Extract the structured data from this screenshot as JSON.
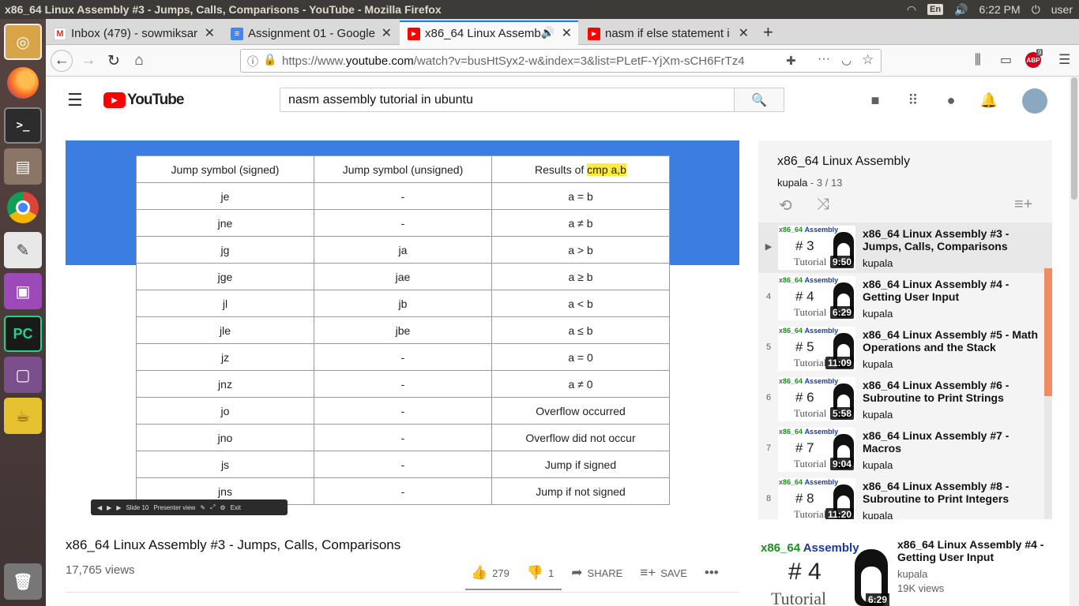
{
  "window": {
    "title": "x86_64 Linux Assembly #3 - Jumps, Calls, Comparisons - YouTube - Mozilla Firefox",
    "kbd_layout": "En",
    "time": "6:22 PM",
    "user": "user"
  },
  "launcher": {
    "items": [
      {
        "name": "ubuntu-dash",
        "glyph": "◎"
      },
      {
        "name": "firefox",
        "glyph": ""
      },
      {
        "name": "terminal",
        "glyph": ">_"
      },
      {
        "name": "files",
        "glyph": "▤"
      },
      {
        "name": "chrome",
        "glyph": ""
      },
      {
        "name": "text-editor",
        "glyph": "✎"
      },
      {
        "name": "app-window",
        "glyph": "▣"
      },
      {
        "name": "pycharm",
        "glyph": "PC"
      },
      {
        "name": "display",
        "glyph": "▢"
      },
      {
        "name": "teapot",
        "glyph": "☕"
      },
      {
        "name": "trash",
        "glyph": "🗑"
      }
    ]
  },
  "tabs": [
    {
      "title": "Inbox (479) - sowmiksar",
      "icon": "gmail-icon"
    },
    {
      "title": "Assignment 01 - Google",
      "icon": "docs-icon"
    },
    {
      "title": "x86_64 Linux Assemb",
      "icon": "youtube-icon"
    },
    {
      "title": "nasm if else statement i",
      "icon": "youtube-icon"
    }
  ],
  "nav": {
    "url_prefix": "https://www.",
    "url_domain": "youtube.com",
    "url_rest": "/watch?v=busHtSyx2-w&index=3&list=PLetF-YjXm-sCH6FrTz4",
    "abp_badge": "9"
  },
  "youtube": {
    "logo": "YouTube",
    "search_value": "nasm assembly tutorial in ubuntu"
  },
  "slide": {
    "headers": [
      "Jump symbol (signed)",
      "Jump symbol (unsigned)",
      "Results of "
    ],
    "highlight": "cmp a,b",
    "rows": [
      [
        "je",
        "-",
        "a = b"
      ],
      [
        "jne",
        "-",
        "a ≠ b"
      ],
      [
        "jg",
        "ja",
        "a > b"
      ],
      [
        "jge",
        "jae",
        "a ≥ b"
      ],
      [
        "jl",
        "jb",
        "a < b"
      ],
      [
        "jle",
        "jbe",
        "a ≤ b"
      ],
      [
        "jz",
        "-",
        "a = 0"
      ],
      [
        "jnz",
        "-",
        "a ≠ 0"
      ],
      [
        "jo",
        "-",
        "Overflow occurred"
      ],
      [
        "jno",
        "-",
        "Overflow did not occur"
      ],
      [
        "js",
        "-",
        "Jump if signed"
      ],
      [
        "jns",
        "-",
        "Jump if not signed"
      ]
    ],
    "controls": {
      "slide": "Slide 10",
      "presenter": "Presenter view",
      "exit": "Exit"
    }
  },
  "video": {
    "title": "x86_64 Linux Assembly #3 - Jumps, Calls, Comparisons",
    "views": "17,765 views",
    "likes": "279",
    "dislikes": "1",
    "share": "SHARE",
    "save": "SAVE"
  },
  "playlist": {
    "title": "x86_64 Linux Assembly",
    "channel": "kupala",
    "position": "3 / 13",
    "items": [
      {
        "idx": "▶",
        "num": "# 3",
        "duration": "9:50",
        "title": "x86_64 Linux Assembly #3 - Jumps, Calls, Comparisons",
        "channel": "kupala"
      },
      {
        "idx": "4",
        "num": "# 4",
        "duration": "6:29",
        "title": "x86_64 Linux Assembly #4 - Getting User Input",
        "channel": "kupala"
      },
      {
        "idx": "5",
        "num": "# 5",
        "duration": "11:09",
        "title": "x86_64 Linux Assembly #5 - Math Operations and the Stack",
        "channel": "kupala"
      },
      {
        "idx": "6",
        "num": "# 6",
        "duration": "5:58",
        "title": "x86_64 Linux Assembly #6 - Subroutine to Print Strings",
        "channel": "kupala"
      },
      {
        "idx": "7",
        "num": "# 7",
        "duration": "9:04",
        "title": "x86_64 Linux Assembly #7 - Macros",
        "channel": "kupala"
      },
      {
        "idx": "8",
        "num": "# 8",
        "duration": "11:20",
        "title": "x86_64 Linux Assembly #8 - Subroutine to Print Integers",
        "channel": "kupala"
      }
    ],
    "thumb_label_green": "x86_64",
    "thumb_label_blue": "Assembly",
    "thumb_tutorial": "Tutorial"
  },
  "recommended": {
    "num": "# 4",
    "duration": "6:29",
    "title": "x86_64 Linux Assembly #4 - Getting User Input",
    "channel": "kupala",
    "views": "19K views"
  }
}
